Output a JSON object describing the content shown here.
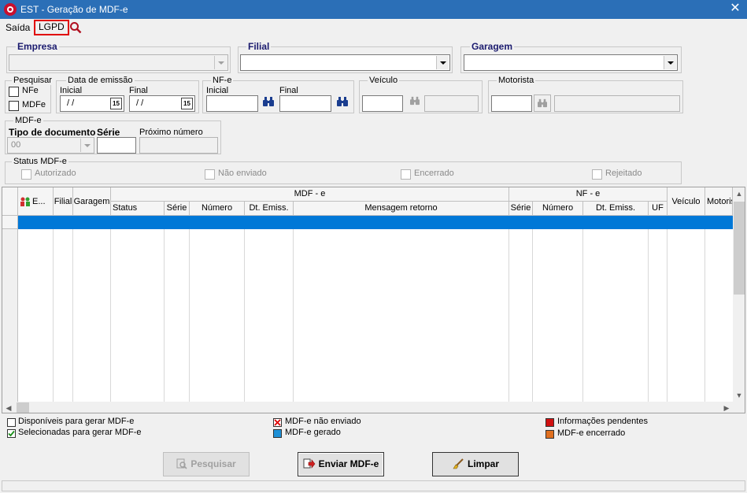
{
  "window": {
    "title": "EST - Geração de MDF-e",
    "close_glyph": "✕"
  },
  "menu": {
    "saida": "Saída",
    "lgpd": "LGPD",
    "search_icon": "search-icon"
  },
  "filters": {
    "empresa": {
      "label": "Empresa",
      "value": ""
    },
    "filial": {
      "label": "Filial",
      "value": ""
    },
    "garagem": {
      "label": "Garagem",
      "value": ""
    },
    "pesquisar": {
      "label": "Pesquisar",
      "nfe": "NFe",
      "mdfe": "MDFe"
    },
    "data_emissao": {
      "label": "Data de emissão",
      "inicial_label": "Inicial",
      "final_label": "Final",
      "inicial_value": "/ /",
      "final_value": "/ /",
      "cal_glyph": "15"
    },
    "nfe": {
      "label": "NF-e",
      "inicial_label": "Inicial",
      "final_label": "Final",
      "inicial_value": "",
      "final_value": ""
    },
    "veiculo": {
      "label": "Veículo",
      "value": ""
    },
    "motorista": {
      "label": "Motorista",
      "value": ""
    },
    "mdfe": {
      "label": "MDF-e",
      "tipo_label": "Tipo de documento",
      "serie_label": "Série",
      "proximo_label": "Próximo número",
      "tipo_value": "00",
      "serie_value": "",
      "proximo_value": ""
    },
    "status_mdfe": {
      "label": "Status MDF-e",
      "autorizado": "Autorizado",
      "nao_enviado": "Não enviado",
      "encerrado": "Encerrado",
      "rejeitado": "Rejeitado"
    }
  },
  "grid": {
    "headers": {
      "e": "E...",
      "filial": "Filial",
      "garagem": "Garagem",
      "mdfe_group": "MDF - e",
      "nfe_group": "NF - e",
      "status": "Status",
      "serie": "Série",
      "numero": "Número",
      "dt_emiss": "Dt. Emiss.",
      "mensagem": "Mensagem retorno",
      "nf_serie": "Série",
      "nf_numero": "Número",
      "nf_dt_emiss": "Dt. Emiss.",
      "uf": "UF",
      "veiculo": "Veículo",
      "motorista": "Motoris"
    },
    "rows": []
  },
  "legend": {
    "disponiveis": "Disponíveis para gerar MDF-e",
    "selecionadas": "Selecionadas para gerar MDF-e",
    "nao_enviado": "MDF-e não enviado",
    "gerado": "MDF-e gerado",
    "pendentes": "Informações pendentes",
    "encerrado": "MDF-e encerrado",
    "colors": {
      "nao_enviado": "#e00000",
      "gerado": "#1e90d6",
      "pendentes": "#d01010",
      "encerrado": "#e07020",
      "selecionadas_check": "#1a8f1a"
    }
  },
  "buttons": {
    "pesquisar": "Pesquisar",
    "enviar": "Enviar MDF-e",
    "limpar": "Limpar"
  }
}
